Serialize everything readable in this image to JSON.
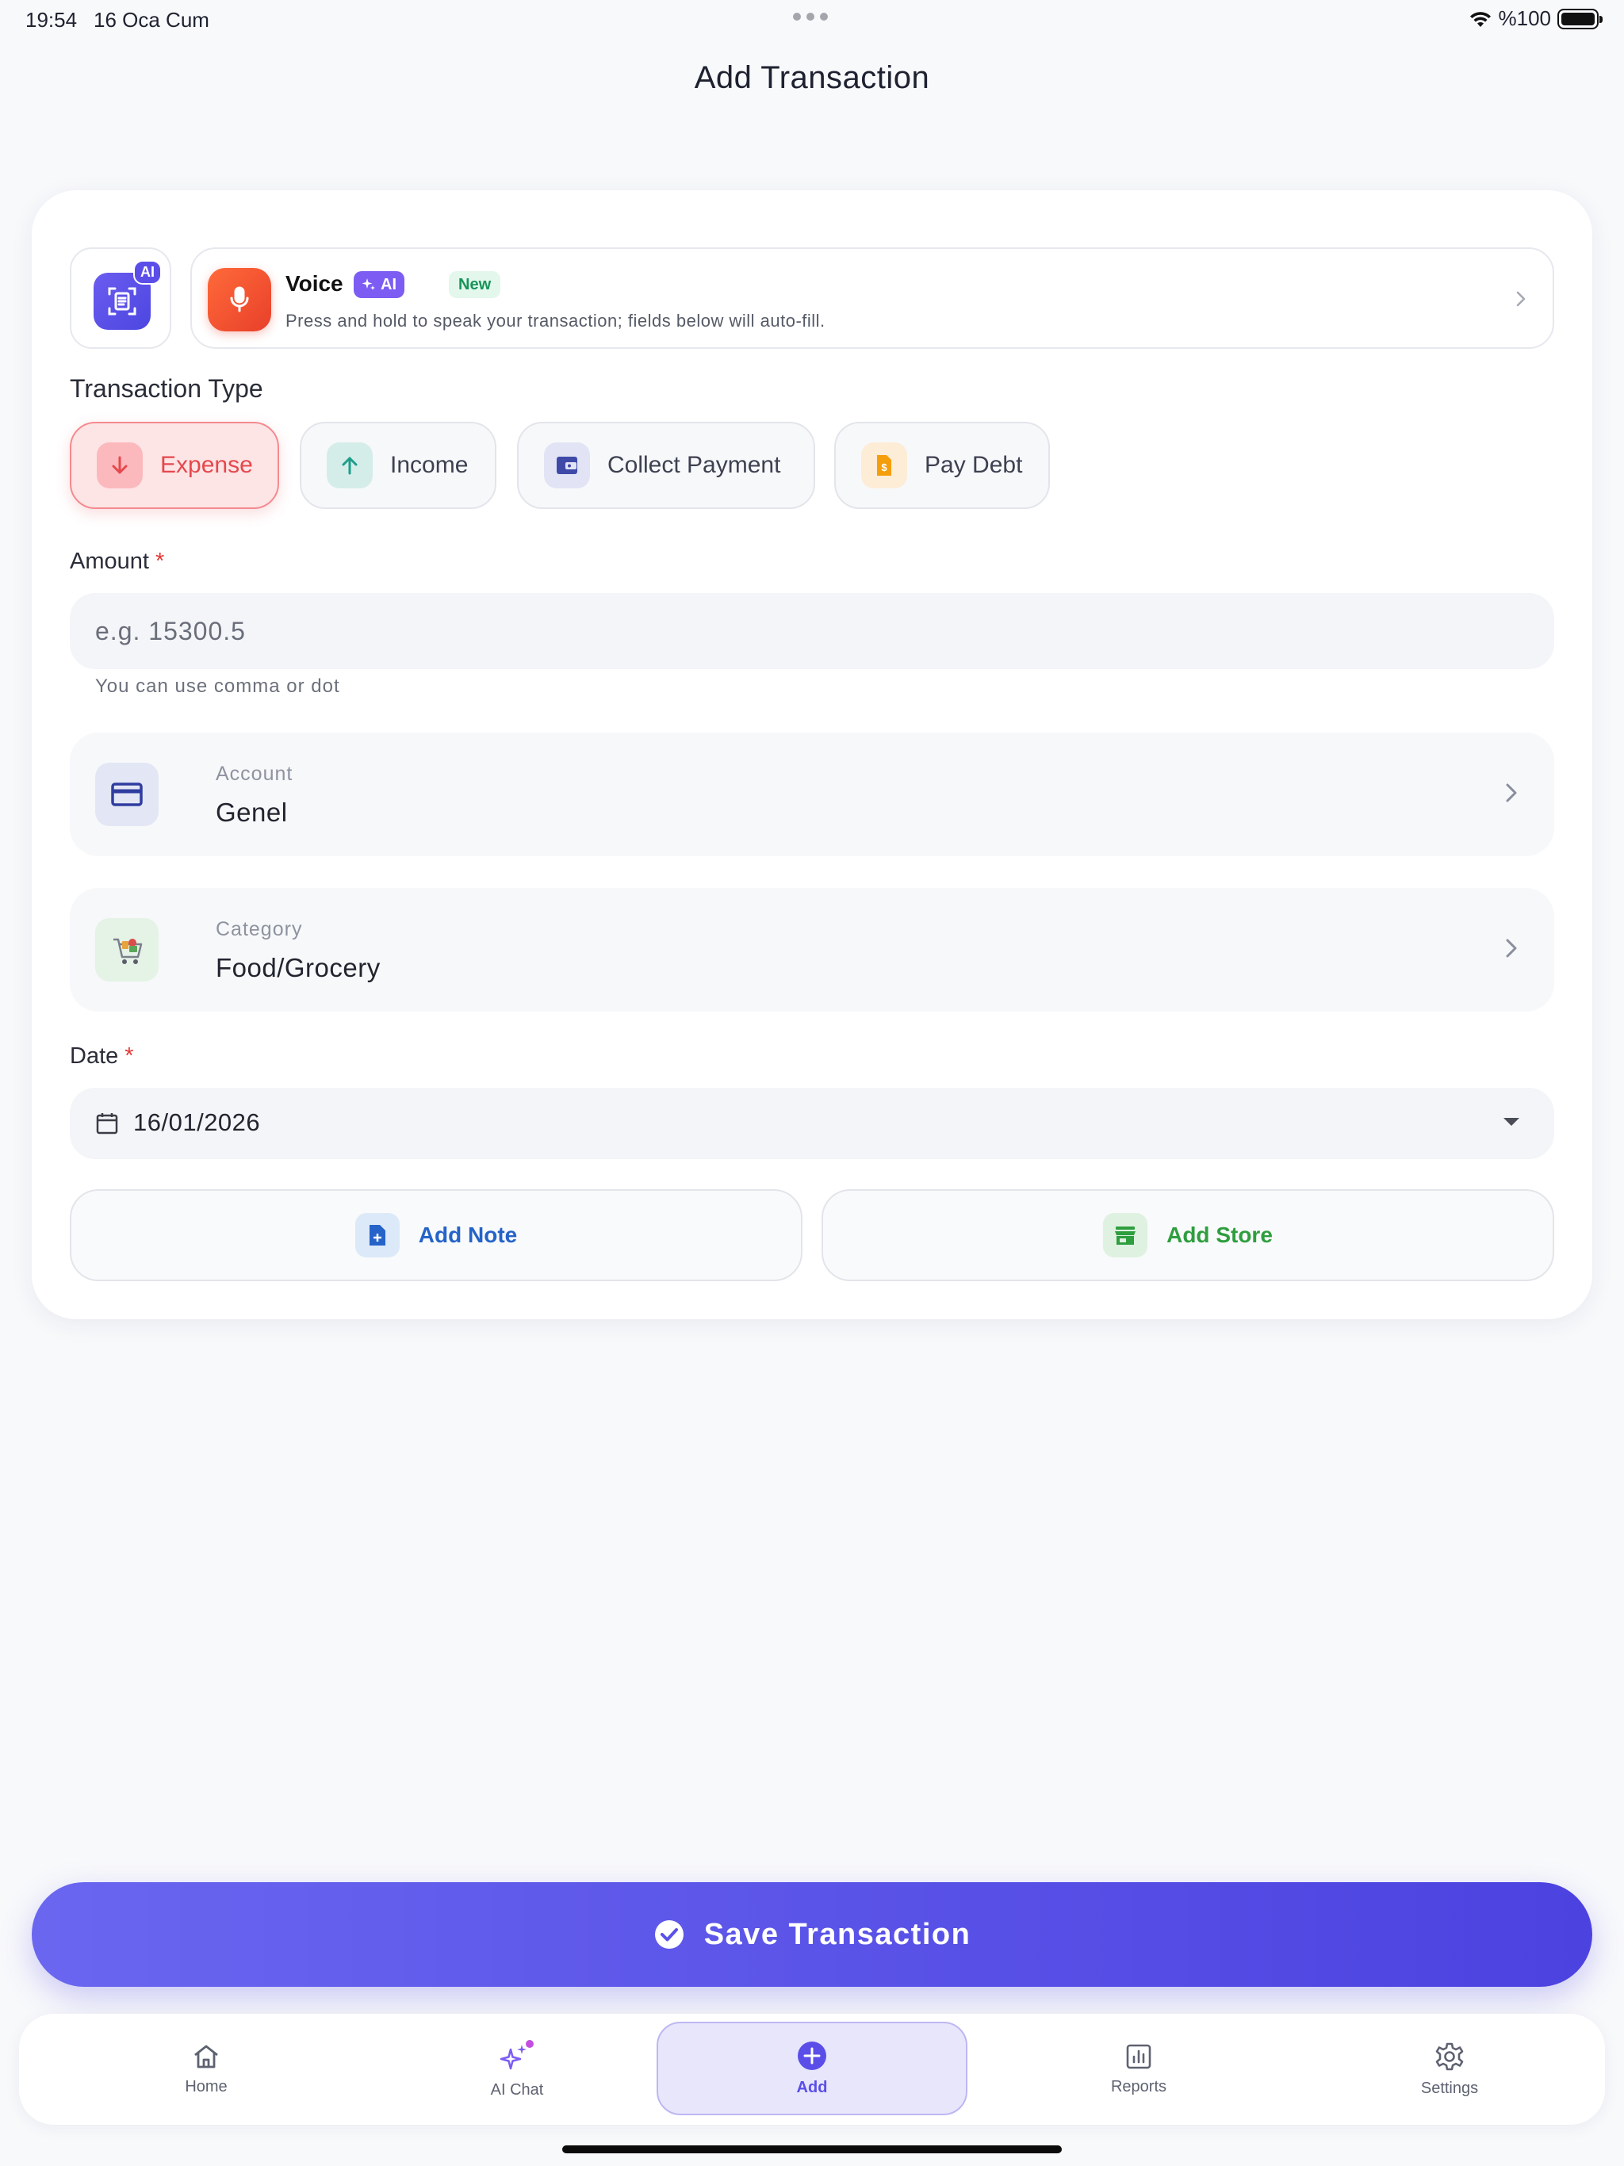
{
  "status_bar": {
    "time": "19:54",
    "date": "16 Oca Cum",
    "battery": "%100"
  },
  "header": {
    "title": "Add Transaction"
  },
  "ai_scan": {
    "badge": "AI"
  },
  "voice": {
    "title": "Voice",
    "ai_badge": "AI",
    "new_badge": "New",
    "subtitle": "Press and hold to speak your transaction; fields below will auto-fill."
  },
  "transaction_type": {
    "label": "Transaction Type",
    "options": [
      {
        "label": "Expense",
        "selected": true
      },
      {
        "label": "Income",
        "selected": false
      },
      {
        "label": "Collect Payment",
        "selected": false
      },
      {
        "label": "Pay Debt",
        "selected": false
      }
    ]
  },
  "amount": {
    "label": "Amount",
    "required_mark": "*",
    "value": "",
    "placeholder": "e.g. 15300.5",
    "helper": "You can use comma or dot"
  },
  "account": {
    "label": "Account",
    "value": "Genel"
  },
  "category": {
    "label": "Category",
    "value": "Food/Grocery"
  },
  "date": {
    "label": "Date",
    "required_mark": "*",
    "value": "16/01/2026"
  },
  "actions": {
    "add_note": "Add Note",
    "add_store": "Add Store"
  },
  "save": {
    "label": "Save Transaction"
  },
  "tab_bar": {
    "items": [
      {
        "label": "Home",
        "icon": "home-icon",
        "active": false
      },
      {
        "label": "AI Chat",
        "icon": "sparkles-icon",
        "active": false
      },
      {
        "label": "Add",
        "icon": "plus-circle-icon",
        "active": true
      },
      {
        "label": "Reports",
        "icon": "chart-icon",
        "active": false
      },
      {
        "label": "Settings",
        "icon": "gear-icon",
        "active": false
      }
    ]
  },
  "colors": {
    "accent": "#5b4ee8",
    "expense": "#e5484d",
    "income": "#1e9e8a",
    "pay_debt": "#f59e0b",
    "add_store": "#2e9e3e",
    "add_note": "#2563c9"
  }
}
